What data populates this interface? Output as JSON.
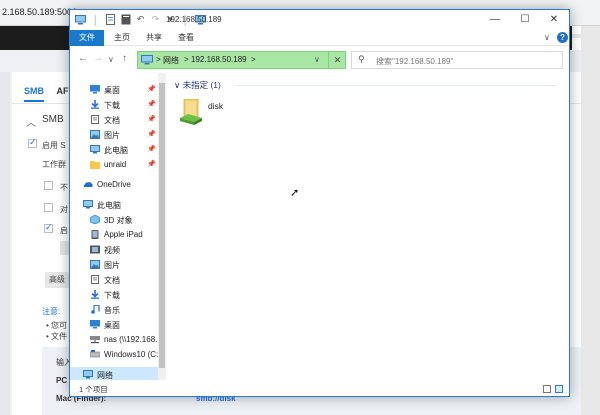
{
  "background": {
    "url_fragment": "2.168.50.189:5000",
    "tabs": [
      "SMB",
      "AF"
    ],
    "section_title": "SMB",
    "rows": [
      {
        "label": "启用 S",
        "checked": true
      },
      {
        "label": "工作群",
        "checked": null
      },
      {
        "label": "不",
        "checked": false
      },
      {
        "label": "对",
        "checked": false
      },
      {
        "label": "启",
        "checked": true
      }
    ],
    "advanced_button": "高级",
    "note_label": "注意:",
    "bullets": [
      "您可",
      "文件"
    ],
    "box_lines": [
      "输入",
      "PC",
      "Mac (Finder):"
    ],
    "box_link": "smb://disk"
  },
  "window": {
    "title": "192.168.50.189",
    "controls": {
      "minimize": "—",
      "maximize": "☐",
      "close": "✕"
    },
    "menu": {
      "file": "文件",
      "home": "主页",
      "share": "共享",
      "view": "查看"
    },
    "address": {
      "segments": [
        "网络",
        "192.168.50.189"
      ],
      "separator": ">"
    },
    "search": {
      "placeholder": "搜索\"192.168.50.189\""
    },
    "nav_pane": {
      "quick_access": [
        {
          "label": "桌面",
          "icon": "desktop-icon",
          "pinned": true
        },
        {
          "label": "下载",
          "icon": "download-icon",
          "pinned": true
        },
        {
          "label": "文档",
          "icon": "document-icon",
          "pinned": true
        },
        {
          "label": "图片",
          "icon": "picture-icon",
          "pinned": true
        },
        {
          "label": "此电脑",
          "icon": "this-pc-icon",
          "pinned": true
        },
        {
          "label": "unraid",
          "icon": "folder-icon",
          "pinned": true
        }
      ],
      "onedrive": "OneDrive",
      "this_pc": "此电脑",
      "this_pc_items": [
        {
          "label": "3D 对象",
          "icon": "3d-objects-icon"
        },
        {
          "label": "Apple iPad",
          "icon": "ipad-icon"
        },
        {
          "label": "视频",
          "icon": "video-icon"
        },
        {
          "label": "图片",
          "icon": "picture-icon"
        },
        {
          "label": "文档",
          "icon": "document-icon"
        },
        {
          "label": "下载",
          "icon": "download-icon"
        },
        {
          "label": "音乐",
          "icon": "music-icon"
        },
        {
          "label": "桌面",
          "icon": "desktop-icon"
        },
        {
          "label": "nas (\\\\192.168.",
          "icon": "network-drive-icon"
        },
        {
          "label": "Windows10 (C:",
          "icon": "drive-icon"
        }
      ],
      "network": "网络"
    },
    "content": {
      "group_header": "未指定 (1)",
      "items": [
        {
          "label": "disk",
          "icon": "shared-folder-icon"
        }
      ]
    },
    "status": {
      "count": "1 个项目"
    }
  }
}
